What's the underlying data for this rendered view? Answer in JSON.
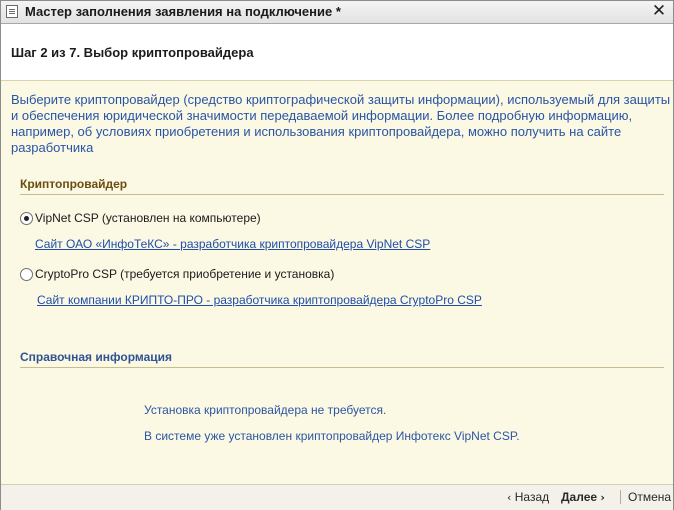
{
  "window": {
    "title": "Мастер заполнения заявления на подключение *",
    "close_glyph": "✕"
  },
  "header": {
    "step_title": "Шаг 2 из 7. Выбор криптопровайдера"
  },
  "description": "Выберите криптопровайдер (средство криптографической защиты информации), используемый для защиты и обеспечения юридической значимости передаваемой информации. Более подробную информацию, например, об условиях приобретения и использования криптопровайдера, можно получить на сайте разработчика",
  "crypto_group": {
    "title": "Криптопровайдер",
    "options": [
      {
        "label": "VipNet CSP (установлен на компьютере)",
        "selected": true,
        "link": "Сайт ОАО «ИнфоТеКС» - разработчика криптопровайдера VipNet CSP"
      },
      {
        "label": "CryptoPro CSP (требуется приобретение и установка)",
        "selected": false,
        "link": "Сайт компании КРИПТО-ПРО - разработчика криптопровайдера CryptoPro CSP"
      }
    ]
  },
  "info_group": {
    "title": "Справочная информация",
    "lines": [
      "Установка криптопровайдера не требуется.",
      "В системе уже установлен криптопровайдер Инфотекс VipNet CSP."
    ]
  },
  "footer": {
    "back_label": "Назад",
    "back_arrow": "‹",
    "next_label": "Далее",
    "next_arrow": "›",
    "cancel_label": "Отмена"
  },
  "colors": {
    "background": "#fbf8e4",
    "link": "#1f4eaa",
    "description_text": "#2a55a5",
    "crypto_group_title": "#6b4d12",
    "info_group_title": "#2f5393"
  },
  "icons": {
    "app": "document-window-icon",
    "close": "close-icon",
    "back": "chevron-left-icon",
    "next": "chevron-right-icon"
  }
}
